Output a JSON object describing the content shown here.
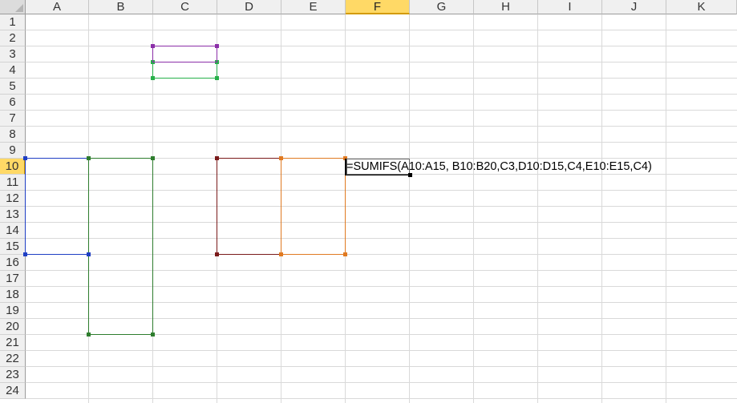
{
  "columns": [
    "A",
    "B",
    "C",
    "D",
    "E",
    "F",
    "G",
    "H",
    "I",
    "J",
    "K"
  ],
  "rows": [
    "1",
    "2",
    "3",
    "4",
    "5",
    "6",
    "7",
    "8",
    "9",
    "10",
    "11",
    "12",
    "13",
    "14",
    "15",
    "16",
    "17",
    "18",
    "19",
    "20",
    "21",
    "22",
    "23",
    "24"
  ],
  "active_column": "F",
  "active_row": "10",
  "formula_text": "=SUMIFS(A10:A15, B10:B20,C3,D10:D15,C4,E10:E15,C4)",
  "range_colors": {
    "a10_a15": "#1f3fc4",
    "b10_b20": "#2e7d2e",
    "c3": "#8b2fa8",
    "c4": "#27b04a",
    "d10_d15": "#7a1a1a",
    "e10_e15": "#e07a22"
  }
}
